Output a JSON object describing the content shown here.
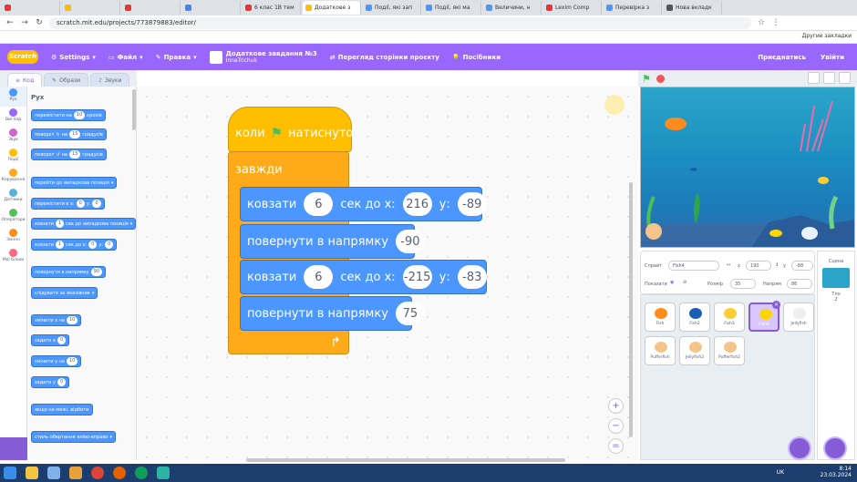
{
  "browser": {
    "tabs": [
      {
        "label": "",
        "color": "#e33"
      },
      {
        "label": "",
        "color": "#fbbc05"
      },
      {
        "label": "",
        "color": "#e33"
      },
      {
        "label": "",
        "color": "#4285f4"
      },
      {
        "label": "6 клас 1В тем",
        "color": "#e33"
      },
      {
        "label": "Додаткове з",
        "color": "#ffbf00",
        "active": true
      },
      {
        "label": "Події, які зап",
        "color": "#4c97ff"
      },
      {
        "label": "Події, які ма",
        "color": "#4c97ff"
      },
      {
        "label": "Величини, н",
        "color": "#4c97ff"
      },
      {
        "label": "Lexim Comp",
        "color": "#e33"
      },
      {
        "label": "Перевірка з",
        "color": "#4c97ff"
      },
      {
        "label": "Нова вкладк",
        "color": "#555"
      }
    ],
    "url": "scratch.mit.edu/projects/773879883/editor/",
    "other_bookmarks": "Другие закладки"
  },
  "menu": {
    "logo": "Scratch",
    "settings": "Settings",
    "file": "Файл",
    "edit": "Правка",
    "project_title": "Додаткове завдання №3",
    "project_author": "InnaTrichuk",
    "see_project": "Перегляд сторінки проєкту",
    "tutorials": "Посібники",
    "share": "Приєднатись",
    "signin": "Увійти"
  },
  "editor_tabs": {
    "code": "Код",
    "costumes": "Образи",
    "sounds": "Звуки"
  },
  "categories": [
    {
      "label": "Рух",
      "color": "#4c97ff"
    },
    {
      "label": "Вигляд",
      "color": "#9966ff"
    },
    {
      "label": "Звук",
      "color": "#cf63cf"
    },
    {
      "label": "Події",
      "color": "#ffbf00"
    },
    {
      "label": "Керування",
      "color": "#ffab19"
    },
    {
      "label": "Датчики",
      "color": "#5cb1d6"
    },
    {
      "label": "Оператори",
      "color": "#59c059"
    },
    {
      "label": "Змінні",
      "color": "#ff8c1a"
    },
    {
      "label": "Мої блоки",
      "color": "#ff6680"
    }
  ],
  "palette": {
    "title": "Рух",
    "b1": "перемістити на",
    "b1v": "10",
    "b1s": "кроків",
    "b2": "поворот",
    "b2v": "15",
    "b2s": "градусів",
    "b3": "поворот",
    "b3v": "15",
    "b3s": "градусів",
    "b4": "перейти до",
    "b4v": "випадкова позиція",
    "b5": "перемістити в х:",
    "b5x": "0",
    "b5y": "0",
    "b6": "ковзати",
    "b6v": "1",
    "b6s": "сек до",
    "b6t": "випадкова позиція",
    "b7": "ковзати",
    "b7v": "1",
    "b7s": "сек до х:",
    "b7x": "0",
    "b7y": "0",
    "b8": "повернути в напрямку",
    "b8v": "90",
    "b9": "слідувати за",
    "b9v": "вказівник",
    "b10": "змінити х на",
    "b10v": "10",
    "b11": "задати х",
    "b11v": "0",
    "b12": "змінити у на",
    "b12v": "10",
    "b13": "задати у",
    "b13v": "0",
    "b14": "якщо на межі, відбити",
    "b15": "стиль обертання",
    "b15v": "вліво-вправо"
  },
  "script": {
    "hat": "коли",
    "hat_suffix": "натиснуто",
    "forever": "завжди",
    "glide1": {
      "label": "ковзати",
      "secs": "6",
      "mid": "сек до х:",
      "x": "216",
      "ylabel": "у:",
      "y": "-89"
    },
    "turn1": {
      "label": "повернути в напрямку",
      "dir": "-90"
    },
    "glide2": {
      "label": "ковзати",
      "secs": "6",
      "mid": "сек до х:",
      "x": "-215",
      "ylabel": "у:",
      "y": "-83"
    },
    "turn2": {
      "label": "повернути в напрямку",
      "dir": "75"
    }
  },
  "zoom": {
    "in": "+",
    "out": "−",
    "reset": "="
  },
  "sprite_info": {
    "sprite_label": "Спрайт",
    "sprite_name": "Fish4",
    "x_label": "х",
    "x_value": "190",
    "y_label": "у",
    "y_value": "-88",
    "show_label": "Показати",
    "size_label": "Розмір",
    "size_value": "35",
    "direction_label": "Напрям",
    "direction_value": "86"
  },
  "sprites": [
    {
      "name": "Fish",
      "color": "#ff8c1a"
    },
    {
      "name": "Fish2",
      "color": "#1b5fb5"
    },
    {
      "name": "Fish3",
      "color": "#ffcc33"
    },
    {
      "name": "Fish4",
      "color": "#ffd500",
      "selected": true
    },
    {
      "name": "Jellyfish",
      "color": "#eeeeee"
    },
    {
      "name": "Pufferfish",
      "color": "#f4c48a"
    },
    {
      "name": "Jellyfish2",
      "color": "#f4c48a"
    },
    {
      "name": "Pufferfish2",
      "color": "#f4c48a"
    }
  ],
  "stage_panel": {
    "title": "Сцена",
    "backdrops_label": "Тло",
    "backdrops_count": "2"
  },
  "taskbar": {
    "lang": "UK",
    "time": "8:14",
    "date": "23.03.2024"
  }
}
